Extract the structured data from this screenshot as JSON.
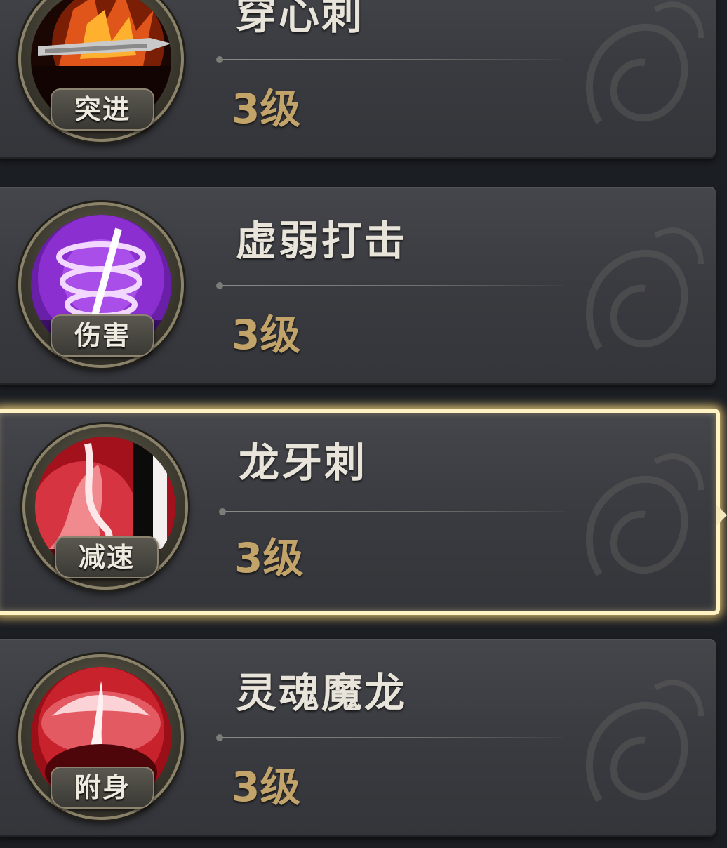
{
  "skills": [
    {
      "name": "穿心刺",
      "tag": "突进",
      "level": "3级",
      "icon": "flaming-spear-icon",
      "selected": false
    },
    {
      "name": "虚弱打击",
      "tag": "伤害",
      "level": "3级",
      "icon": "purple-vortex-icon",
      "selected": false
    },
    {
      "name": "龙牙刺",
      "tag": "减速",
      "level": "3级",
      "icon": "red-fang-strike-icon",
      "selected": true
    },
    {
      "name": "灵魂魔龙",
      "tag": "附身",
      "level": "3级",
      "icon": "soul-dragon-icon",
      "selected": false
    }
  ],
  "colors": {
    "card_bg": "#3c3d42",
    "name_text": "#e8e4da",
    "level_text": "#c2a46a",
    "selected_border": "#fff3c4"
  }
}
